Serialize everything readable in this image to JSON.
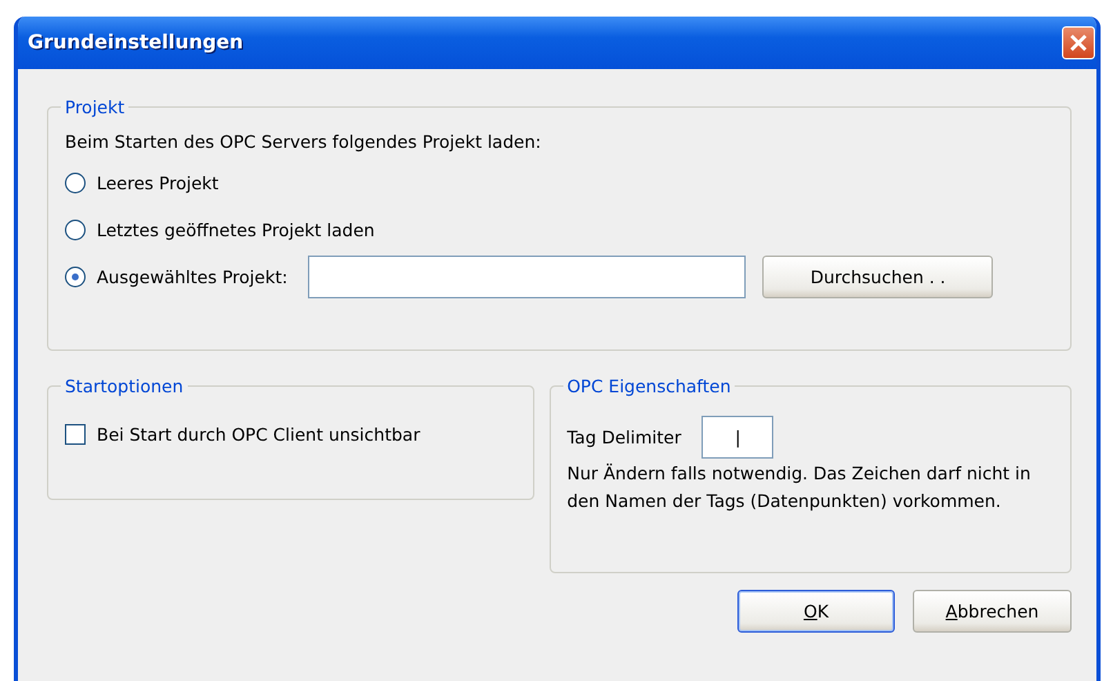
{
  "window": {
    "title": "Grundeinstellungen"
  },
  "projekt": {
    "legend": "Projekt",
    "intro": "Beim Starten des OPC Servers folgendes Projekt laden:",
    "options": [
      {
        "label": "Leeres Projekt",
        "selected": false
      },
      {
        "label": "Letztes geöffnetes Projekt laden",
        "selected": false
      },
      {
        "label": "Ausgewähltes Projekt:",
        "selected": true
      }
    ],
    "browse_button": "Durchsuchen . ."
  },
  "startoptionen": {
    "legend": "Startoptionen",
    "checkbox": {
      "label": "Bei Start durch OPC Client unsichtbar",
      "checked": false
    }
  },
  "opc": {
    "legend": "OPC Eigenschaften",
    "delimiter_label": "Tag Delimiter",
    "delimiter_value": "|",
    "note": "Nur Ändern falls notwendig. Das Zeichen darf nicht in den Namen der Tags (Datenpunkten) vorkommen."
  },
  "buttons": [
    {
      "label": "OK",
      "default": true,
      "access_key_underlined": true
    },
    {
      "label": "Abbrechen",
      "default": false,
      "access_key_underlined": true
    }
  ]
}
